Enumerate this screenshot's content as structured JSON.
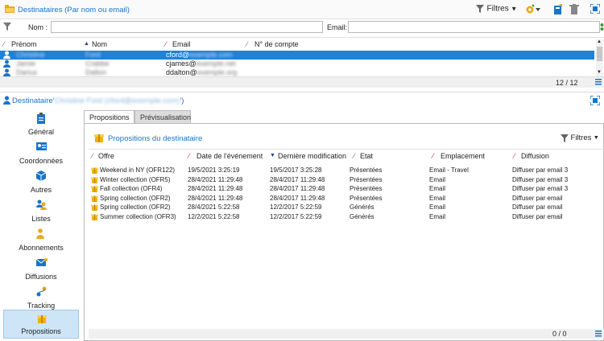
{
  "top_panel": {
    "title": "Destinataires (Par nom ou email)",
    "filtres_label": "Filtres",
    "nom_label": "Nom :",
    "email_label": "Email:",
    "columns": [
      "Prénom",
      "Nom",
      "Email",
      "N° de compte"
    ],
    "rows": [
      {
        "prenom": "Christine",
        "nom": "Ford",
        "email_visible": "cford@",
        "email_domain": "exemple.com",
        "selected": true
      },
      {
        "prenom": "Jamie",
        "nom": "Crabbe",
        "email_visible": "cjames@",
        "email_domain": "exemple.net",
        "selected": false
      },
      {
        "prenom": "Darius",
        "nom": "Dalton",
        "email_visible": "ddalton@",
        "email_domain": "exemple.org",
        "selected": false
      }
    ],
    "pager": "12 / 12"
  },
  "recipient": {
    "label": "Destinataire",
    "quote_open": "'",
    "name": "Christine Ford (cford@exemple.com)",
    "quote_close": "')"
  },
  "sidebar": [
    {
      "label": "Général",
      "icon": "clipboard-icon",
      "active": false
    },
    {
      "label": "Coordonnées",
      "icon": "contact-card-icon",
      "active": false
    },
    {
      "label": "Autres",
      "icon": "cube-icon",
      "active": false
    },
    {
      "label": "Listes",
      "icon": "people-list-icon",
      "active": false
    },
    {
      "label": "Abonnements",
      "icon": "person-icon",
      "active": false
    },
    {
      "label": "Diffusions",
      "icon": "envelope-icon",
      "active": false
    },
    {
      "label": "Tracking",
      "icon": "tracking-icon",
      "active": false
    },
    {
      "label": "Propositions",
      "icon": "offer-icon",
      "active": true
    }
  ],
  "tabs": [
    "Propositions",
    "Prévisualisation"
  ],
  "propositions": {
    "title": "Propositions du destinataire",
    "filtres_label": "Filtres",
    "columns": [
      "Offre",
      "Date de l'événement",
      "Dernière modification",
      "Etat",
      "Emplacement",
      "Diffusion"
    ],
    "rows": [
      {
        "offre": "Weekend in NY (OFR122)",
        "date": "19/5/2021 3:25:19",
        "modif": "19/5/2017 3:25:28",
        "etat": "Présentées",
        "emplacement": "Email - Travel",
        "diffusion": "Diffuser par email 3"
      },
      {
        "offre": "Winter collection (OFR5)",
        "date": "28/4/2021 11:29:48",
        "modif": "28/4/2017 11:29:48",
        "etat": "Présentées",
        "emplacement": "Email",
        "diffusion": "Diffuser par email 3"
      },
      {
        "offre": "Fall collection (OFR4)",
        "date": "28/4/2021 11:29:48",
        "modif": "28/4/2017 11:29:48",
        "etat": "Présentées",
        "emplacement": "Email",
        "diffusion": "Diffuser par email 3"
      },
      {
        "offre": "Spring collection (OFR2)",
        "date": "28/4/2021 11:29:48",
        "modif": "28/4/2017 11:29:48",
        "etat": "Présentées",
        "emplacement": "Email",
        "diffusion": "Diffuser par email"
      },
      {
        "offre": "Spring collection (OFR2)",
        "date": "28/4/2021 5:22:58",
        "modif": "12/2/2017 5:22:59",
        "etat": "Générés",
        "emplacement": "Email",
        "diffusion": "Diffuser par email"
      },
      {
        "offre": "Summer collection (OFR3)",
        "date": "12/2/2021 5:22:58",
        "modif": "12/2/2017 5:22:59",
        "etat": "Générés",
        "emplacement": "Email",
        "diffusion": "Diffuser par email"
      }
    ],
    "pager": "0 / 0"
  },
  "colors": {
    "accent": "#1a73c9",
    "selection": "#1e82d7",
    "sidebar_active": "#cde5f7",
    "offer_icon": "#f0b400"
  }
}
